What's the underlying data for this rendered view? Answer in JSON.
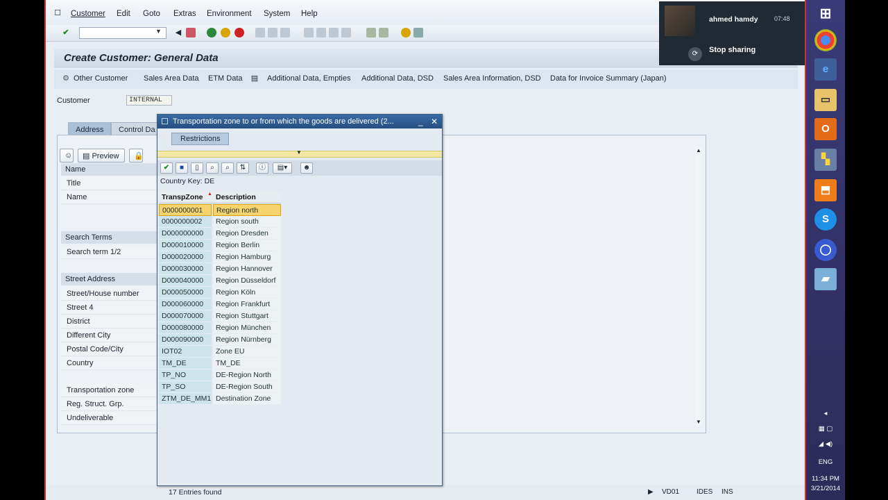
{
  "menubar": {
    "items": [
      "Customer",
      "Edit",
      "Goto",
      "Extras",
      "Environment",
      "System",
      "Help"
    ]
  },
  "screen_title": "Create Customer: General Data",
  "app_toolbar": {
    "items": [
      "Other Customer",
      "Sales Area Data",
      "ETM Data",
      "Additional Data, Empties",
      "Additional Data, DSD",
      "Sales Area Information, DSD",
      "Data for Invoice Summary (Japan)"
    ]
  },
  "customer": {
    "label": "Customer",
    "value": "INTERNAL"
  },
  "tabs": [
    "Address",
    "Control Da"
  ],
  "preview_button": "Preview",
  "name_section": {
    "header": "Name",
    "rows": [
      "Title",
      "Name"
    ]
  },
  "search_section": {
    "header": "Search Terms",
    "rows": [
      "Search term 1/2"
    ]
  },
  "street_section": {
    "header": "Street Address",
    "rows": [
      "Street/House number",
      "Street 4",
      "District",
      "Different City",
      "Postal Code/City",
      "Country",
      "",
      "Transportation zone",
      "Reg. Struct. Grp.",
      "Undeliverable"
    ]
  },
  "dialog": {
    "title": "Transportation zone to or from which the goods are delivered (2...",
    "restrictions_tab": "Restrictions",
    "country_key": "Country Key: DE",
    "columns": [
      "TranspZone",
      "Description"
    ],
    "rows": [
      [
        "0000000001",
        "Region north"
      ],
      [
        "0000000002",
        "Region south"
      ],
      [
        "D000000000",
        "Region Dresden"
      ],
      [
        "D000010000",
        "Region Berlin"
      ],
      [
        "D000020000",
        "Region Hamburg"
      ],
      [
        "D000030000",
        "Region Hannover"
      ],
      [
        "D000040000",
        "Region Düsseldorf"
      ],
      [
        "D000050000",
        "Region Köln"
      ],
      [
        "D000060000",
        "Region Frankfurt"
      ],
      [
        "D000070000",
        "Region Stuttgart"
      ],
      [
        "D000080000",
        "Region München"
      ],
      [
        "D000090000",
        "Region Nürnberg"
      ],
      [
        "IOT02",
        "Zone EU"
      ],
      [
        "TM_DE",
        "TM_DE"
      ],
      [
        "TP_NO",
        "DE-Region North"
      ],
      [
        "TP_SO",
        "DE-Region South"
      ],
      [
        "ZTM_DE_MM1",
        "Destination Zone"
      ]
    ],
    "status": "17 Entries found"
  },
  "statusbar": {
    "tcode": "VD01",
    "system": "IDES",
    "mode": "INS"
  },
  "meeting": {
    "user": "ahmed hamdy",
    "time": "07:48",
    "stop": "Stop sharing"
  },
  "taskbar": {
    "lang": "ENG",
    "time": "11:34 PM",
    "date": "3/21/2014"
  },
  "colors": {
    "selected_row": "#f6d36c",
    "key_column": "#cde4ea",
    "dialog_title": "#264f82"
  }
}
